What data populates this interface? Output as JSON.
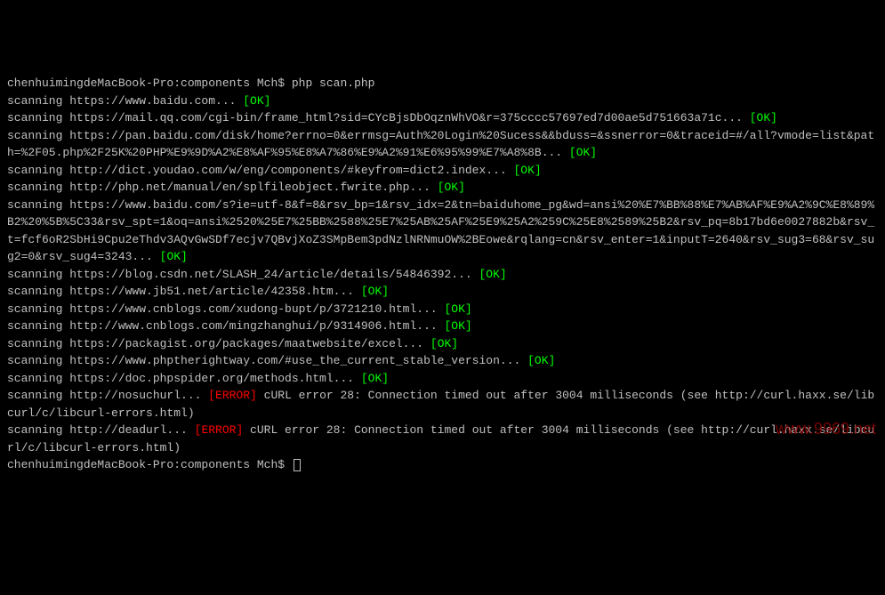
{
  "prompt1": "chenhuimingdeMacBook-Pro:components Mch$ php scan.php",
  "lines": [
    {
      "text": "scanning https://www.baidu.com... ",
      "status": "ok",
      "status_text": "[OK]"
    },
    {
      "text": "scanning https://mail.qq.com/cgi-bin/frame_html?sid=CYcBjsDbOqznWhVO&r=375cccc57697ed7d00ae5d751663a71c... ",
      "status": "ok",
      "status_text": "[OK]"
    },
    {
      "text": "scanning https://pan.baidu.com/disk/home?errno=0&errmsg=Auth%20Login%20Sucess&&bduss=&ssnerror=0&traceid=#/all?vmode=list&path=%2F05.php%2F25K%20PHP%E9%9D%A2%E8%AF%95%E8%A7%86%E9%A2%91%E6%95%99%E7%A8%8B... ",
      "status": "ok",
      "status_text": "[OK]"
    },
    {
      "text": "scanning http://dict.youdao.com/w/eng/components/#keyfrom=dict2.index... ",
      "status": "ok",
      "status_text": "[OK]"
    },
    {
      "text": "scanning http://php.net/manual/en/splfileobject.fwrite.php... ",
      "status": "ok",
      "status_text": "[OK]"
    },
    {
      "text": "scanning https://www.baidu.com/s?ie=utf-8&f=8&rsv_bp=1&rsv_idx=2&tn=baiduhome_pg&wd=ansi%20%E7%BB%88%E7%AB%AF%E9%A2%9C%E8%89%B2%20%5B%5C33&rsv_spt=1&oq=ansi%2520%25E7%25BB%2588%25E7%25AB%25AF%25E9%25A2%259C%25E8%2589%25B2&rsv_pq=8b17bd6e0027882b&rsv_t=fcf6oR2SbHi9Cpu2eThdv3AQvGwSDf7ecjv7QBvjXoZ3SMpBem3pdNzlNRNmuOW%2BEowe&rqlang=cn&rsv_enter=1&inputT=2640&rsv_sug3=68&rsv_sug2=0&rsv_sug4=3243... ",
      "status": "ok",
      "status_text": "[OK]"
    },
    {
      "text": "scanning https://blog.csdn.net/SLASH_24/article/details/54846392... ",
      "status": "ok",
      "status_text": "[OK]"
    },
    {
      "text": "scanning https://www.jb51.net/article/42358.htm... ",
      "status": "ok",
      "status_text": "[OK]"
    },
    {
      "text": "scanning https://www.cnblogs.com/xudong-bupt/p/3721210.html... ",
      "status": "ok",
      "status_text": "[OK]"
    },
    {
      "text": "scanning http://www.cnblogs.com/mingzhanghui/p/9314906.html... ",
      "status": "ok",
      "status_text": "[OK]"
    },
    {
      "text": "scanning https://packagist.org/packages/maatwebsite/excel... ",
      "status": "ok",
      "status_text": "[OK]"
    },
    {
      "text": "scanning https://www.phptherightway.com/#use_the_current_stable_version... ",
      "status": "ok",
      "status_text": "[OK]"
    },
    {
      "text": "scanning https://doc.phpspider.org/methods.html... ",
      "status": "ok",
      "status_text": "[OK]"
    },
    {
      "text": "scanning http://nosuchurl... ",
      "status": "error",
      "status_text": "[ERROR]",
      "suffix": " cURL error 28: Connection timed out after 3004 milliseconds (see http://curl.haxx.se/libcurl/c/libcurl-errors.html)"
    },
    {
      "text": "scanning http://deadurl... ",
      "status": "error",
      "status_text": "[ERROR]",
      "suffix": " cURL error 28: Connection timed out after 3004 milliseconds (see http://curl.haxx.se/libcurl/c/libcurl-errors.html)"
    }
  ],
  "prompt2": "chenhuimingdeMacBook-Pro:components Mch$ ",
  "watermark": "www.9969.net"
}
